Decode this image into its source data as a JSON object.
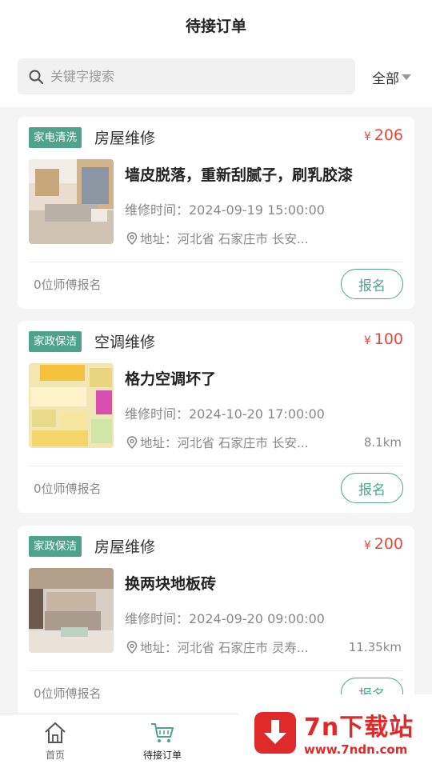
{
  "header": {
    "title": "待接订单"
  },
  "search": {
    "placeholder": "关键字搜索",
    "filter_label": "全部"
  },
  "orders": [
    {
      "tag": "家电清洗",
      "category": "房屋维修",
      "currency": "¥",
      "price": "206",
      "title": "墙皮脱落，重新刮腻子，刷乳胶漆",
      "time": "维修时间：2024-09-19 15:00:00",
      "address": "地址：河北省 石家庄市 长安...",
      "distance": "",
      "signup_count": "0位师傅报名",
      "signup_label": "报名"
    },
    {
      "tag": "家政保洁",
      "category": "空调维修",
      "currency": "¥",
      "price": "100",
      "title": "格力空调坏了",
      "time": "维修时间：2024-10-20 17:00:00",
      "address": "地址：河北省 石家庄市 长安...",
      "distance": "8.1km",
      "signup_count": "0位师傅报名",
      "signup_label": "报名"
    },
    {
      "tag": "家政保洁",
      "category": "房屋维修",
      "currency": "¥",
      "price": "200",
      "title": "换两块地板砖",
      "time": "维修时间：2024-09-20 09:00:00",
      "address": "地址：河北省 石家庄市 灵寿...",
      "distance": "11.35km",
      "signup_count": "0位师傅报名",
      "signup_label": "报名"
    }
  ],
  "tabbar": {
    "home": "首页",
    "orders": "待接订单"
  },
  "watermark": {
    "title": "7n下载站",
    "url": "www.7ndn.com"
  },
  "colors": {
    "accent": "#4fa38d",
    "price": "#e5493b",
    "watermark": "#e02a2a"
  }
}
